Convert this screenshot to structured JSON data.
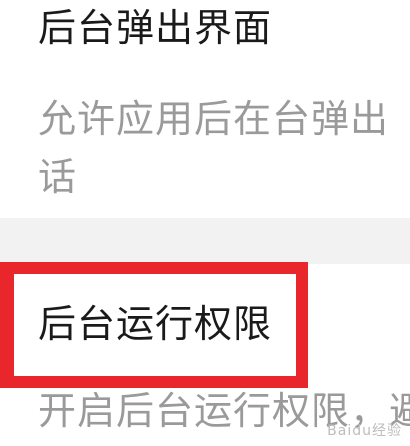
{
  "settings": {
    "background_popup": {
      "title": "后台弹出界面",
      "description": "允许应用后在台弹出话"
    },
    "background_run": {
      "title": "后台运行权限",
      "description_partial": "开启后台运行权限，避免进程被误杀，保"
    }
  },
  "annotation": {
    "highlight_color": "#e8262c"
  },
  "watermark": {
    "text": "Baidu经验"
  }
}
